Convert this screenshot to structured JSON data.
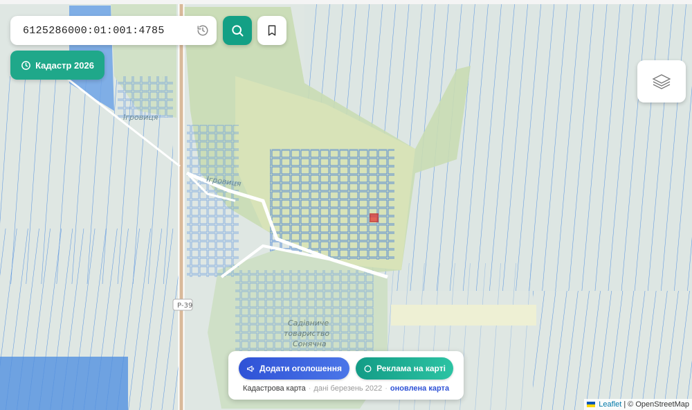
{
  "search": {
    "value": "6125286000:01:001:4785"
  },
  "controls": {
    "kadastr_label": "Кадастр 2026",
    "layers_icon": "layers-icon",
    "history_icon": "history-icon",
    "search_icon": "search-icon",
    "bookmark_icon": "bookmark-icon"
  },
  "map_labels": {
    "village_1": "Ігровиця",
    "village_2": "Ігровиця",
    "road": "Р-39",
    "garden_line1": "Садівниче",
    "garden_line2": "товариство",
    "garden_line3": "Сонячна"
  },
  "bottom_panel": {
    "add_ad_label": "Додати оголошення",
    "promo_label": "Реклама на карті",
    "map_title": "Кадастрова карта",
    "date_text": "дані березень 2022",
    "updated_link": "оновлена карта"
  },
  "attribution": {
    "leaflet": "Leaflet",
    "separator": "|",
    "osm": "© OpenStreetMap"
  },
  "colors": {
    "accent": "#13a085",
    "parcel_stroke": "#5b95e0",
    "selected_parcel": "#e53935",
    "button_blue": "#2f52d6"
  }
}
